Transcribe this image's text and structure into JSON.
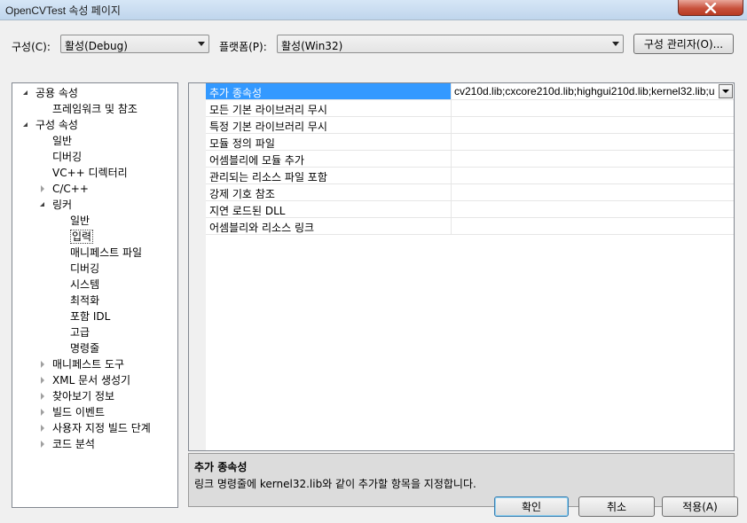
{
  "window": {
    "title": "OpenCVTest 속성 페이지"
  },
  "toolbar": {
    "config_label": "구성(C):",
    "config_value": "활성(Debug)",
    "platform_label": "플랫폼(P):",
    "platform_value": "활성(Win32)",
    "config_manager_label": "구성 관리자(O)..."
  },
  "tree": {
    "items": [
      {
        "label": "공용 속성",
        "level": 0,
        "expander": "open"
      },
      {
        "label": "프레임워크 및 참조",
        "level": 1,
        "expander": "none"
      },
      {
        "label": "구성 속성",
        "level": 0,
        "expander": "open"
      },
      {
        "label": "일반",
        "level": 1,
        "expander": "none"
      },
      {
        "label": "디버깅",
        "level": 1,
        "expander": "none"
      },
      {
        "label": "VC++ 디렉터리",
        "level": 1,
        "expander": "none"
      },
      {
        "label": "C/C++",
        "level": 1,
        "expander": "closed"
      },
      {
        "label": "링커",
        "level": 1,
        "expander": "open"
      },
      {
        "label": "일반",
        "level": 2,
        "expander": "none"
      },
      {
        "label": "입력",
        "level": 2,
        "expander": "none",
        "selected": true
      },
      {
        "label": "매니페스트 파일",
        "level": 2,
        "expander": "none"
      },
      {
        "label": "디버깅",
        "level": 2,
        "expander": "none"
      },
      {
        "label": "시스템",
        "level": 2,
        "expander": "none"
      },
      {
        "label": "최적화",
        "level": 2,
        "expander": "none"
      },
      {
        "label": "포함 IDL",
        "level": 2,
        "expander": "none"
      },
      {
        "label": "고급",
        "level": 2,
        "expander": "none"
      },
      {
        "label": "명령줄",
        "level": 2,
        "expander": "none"
      },
      {
        "label": "매니페스트 도구",
        "level": 1,
        "expander": "closed"
      },
      {
        "label": "XML 문서 생성기",
        "level": 1,
        "expander": "closed"
      },
      {
        "label": "찾아보기 정보",
        "level": 1,
        "expander": "closed"
      },
      {
        "label": "빌드 이벤트",
        "level": 1,
        "expander": "closed"
      },
      {
        "label": "사용자 지정 빌드 단계",
        "level": 1,
        "expander": "closed"
      },
      {
        "label": "코드 분석",
        "level": 1,
        "expander": "closed"
      }
    ]
  },
  "grid": {
    "rows": [
      {
        "name": "추가 종속성",
        "value": "cv210d.lib;cxcore210d.lib;highgui210d.lib;kernel32.lib;u",
        "selected": true
      },
      {
        "name": "모든 기본 라이브러리 무시",
        "value": ""
      },
      {
        "name": "특정 기본 라이브러리 무시",
        "value": ""
      },
      {
        "name": "모듈 정의 파일",
        "value": ""
      },
      {
        "name": "어셈블리에 모듈 추가",
        "value": ""
      },
      {
        "name": "관리되는 리소스 파일 포함",
        "value": ""
      },
      {
        "name": "강제 기호 참조",
        "value": ""
      },
      {
        "name": "지연 로드된 DLL",
        "value": ""
      },
      {
        "name": "어셈블리와 리소스 링크",
        "value": ""
      }
    ]
  },
  "description": {
    "title": "추가 종속성",
    "text": "링크 명령줄에 kernel32.lib와 같이 추가할 항목을 지정합니다."
  },
  "buttons": {
    "ok": "확인",
    "cancel": "취소",
    "apply": "적용(A)"
  }
}
